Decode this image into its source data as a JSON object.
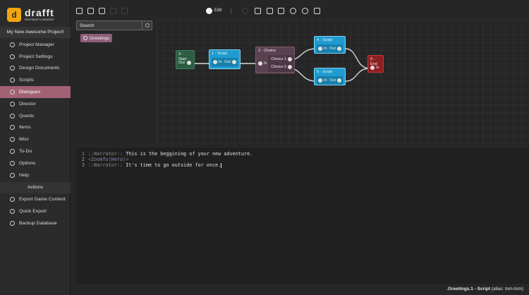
{
  "brand": {
    "name": "drafft",
    "tagline": "developer's paradise"
  },
  "project": {
    "name": "My New Awesome Project!"
  },
  "sidebar": {
    "items": [
      {
        "label": "Project Manager",
        "icon": "home-icon"
      },
      {
        "label": "Project Settings",
        "icon": "settings-icon"
      },
      {
        "label": "Design Documents",
        "icon": "document-icon"
      },
      {
        "label": "Scripts",
        "icon": "script-icon"
      },
      {
        "label": "Dialogues",
        "icon": "dialogue-icon",
        "active": true
      },
      {
        "label": "Director",
        "icon": "director-icon"
      },
      {
        "label": "Quests",
        "icon": "quest-icon"
      },
      {
        "label": "Items",
        "icon": "items-icon"
      },
      {
        "label": "Misc",
        "icon": "misc-icon"
      },
      {
        "label": "To-Do",
        "icon": "todo-icon"
      },
      {
        "label": "Options",
        "icon": "options-icon"
      },
      {
        "label": "Help",
        "icon": "help-icon"
      }
    ],
    "actions_header": "Actions",
    "actions": [
      {
        "label": "Export Game Content",
        "icon": "export-icon"
      },
      {
        "label": "Quick Export",
        "icon": "quick-export-icon"
      },
      {
        "label": "Backup Database",
        "icon": "database-icon"
      }
    ]
  },
  "toolbar": {
    "edit_label": "Edit"
  },
  "search": {
    "placeholder": "Search",
    "value": ""
  },
  "results": [
    {
      "label": "Greetings"
    }
  ],
  "graph": {
    "start": {
      "title": "3 - Start",
      "out": "Out"
    },
    "script1": {
      "title": "1 - Script",
      "in": "In",
      "out": "Out"
    },
    "choice": {
      "title": "2 - Choice",
      "in": "In",
      "choice1": "Choice 1",
      "choice2": "Choice 2"
    },
    "script4": {
      "title": "4 - Script",
      "in": "In",
      "out": "Out"
    },
    "script5": {
      "title": "5 - Script",
      "in": "In",
      "out": "Out"
    },
    "end": {
      "title": "6 - End",
      "in": "In"
    }
  },
  "editor": {
    "line_numbers": [
      "1",
      "2",
      "3"
    ],
    "line1": {
      "name": "::Narrator::",
      "text": " This is the beggining of your new adventure."
    },
    "line2": {
      "open": "<",
      "fn": "ZoomTo",
      "paren_open": "(",
      "arg": "Hero",
      "paren_close": ")",
      "close": ">"
    },
    "line3": {
      "name": "::Narrator::",
      "text": " It's time to go outside for once."
    }
  },
  "status": {
    "path": ".Greetings.1 - Script",
    "alias": " (alias: tom-tom)"
  },
  "colors": {
    "accent": "#a06274",
    "start_node": "#2d5d43",
    "script_node": "#1f9bcf",
    "choice_node": "#5a4150",
    "end_node": "#8d1f22",
    "brand": "#f2a50c"
  }
}
